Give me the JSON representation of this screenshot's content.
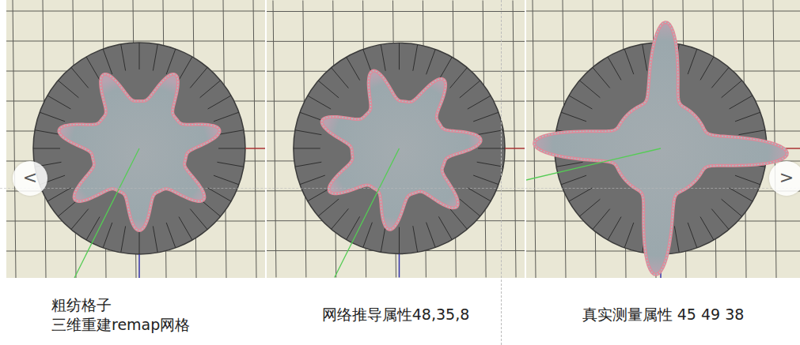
{
  "panels": [
    {
      "kind": "flower",
      "caption": [
        "粗纺格子",
        "三维重建remap网格"
      ]
    },
    {
      "kind": "flower",
      "caption": [
        "网络推导属性48,35,8"
      ]
    },
    {
      "kind": "star",
      "caption": [
        "真实测量属性 45 49 38"
      ]
    }
  ],
  "carousel": {
    "prev": "<",
    "next": ">"
  }
}
